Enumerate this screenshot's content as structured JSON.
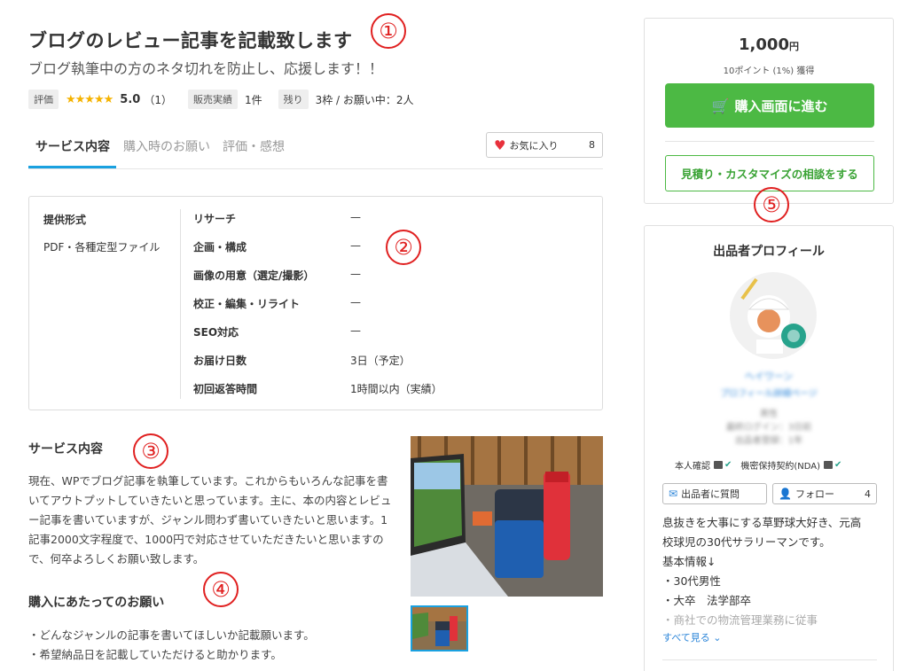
{
  "service": {
    "title": "ブログのレビュー記事を記載致します",
    "subtitle": "ブログ執筆中の方のネタ切れを防止し、応援します！！"
  },
  "meta": {
    "rating_tag": "評価",
    "stars": "★★★★★",
    "rating_value": "5.0",
    "rating_count": "（1）",
    "sales_tag": "販売実績",
    "sales_value": "1件",
    "remaining_tag": "残り",
    "remaining_value": "3枠 / お願い中：2人"
  },
  "tabs": [
    {
      "label": "サービス内容"
    },
    {
      "label": "購入時のお願い"
    },
    {
      "label": "評価・感想"
    }
  ],
  "favorite": {
    "label": "お気に入り",
    "count": "8"
  },
  "spec": {
    "format_label": "提供形式",
    "format_value": "PDF・各種定型ファイル",
    "rows": [
      {
        "k": "リサーチ",
        "v": "—"
      },
      {
        "k": "企画・構成",
        "v": "—"
      },
      {
        "k": "画像の用意（選定/撮影）",
        "v": "—"
      },
      {
        "k": "校正・編集・リライト",
        "v": "—"
      },
      {
        "k": "SEO対応",
        "v": "—"
      },
      {
        "k": "お届け日数",
        "v": "3日（予定）"
      },
      {
        "k": "初回返答時間",
        "v": "1時間以内（実績）"
      }
    ]
  },
  "content": {
    "heading": "サービス内容",
    "body": "現在、WPでブログ記事を執筆しています。これからもいろんな記事を書いてアウトプットしていきたいと思っています。主に、本の内容とレビュー記事を書いていますが、ジャンル問わず書いていきたいと思います。1記事2000文字程度で、1000円で対応させていただきたいと思いますので、何卒よろしくお願い致します。"
  },
  "request": {
    "heading": "購入にあたってのお願い",
    "items": [
      "・どんなジャンルの記事を書いてほしいか記載願います。",
      "・希望納品日を記載していただけると助かります。"
    ]
  },
  "purchase": {
    "price": "1,000",
    "currency": "円",
    "points": "10ポイント (1%) 獲得",
    "buy_label": "購入画面に進む",
    "consult_label": "見積り・カスタマイズの相談をする"
  },
  "profile": {
    "title": "出品者プロフィール",
    "verify_label": "本人確認",
    "nda_label": "機密保持契約(NDA)",
    "message_label": "出品者に質問",
    "follow_label": "フォロー",
    "follow_count": "4",
    "bio_lines": [
      "息抜きを大事にする草野球大好き、元高",
      "校球児の30代サラリーマンです。",
      "基本情報↓",
      "・30代男性",
      "・大卒　法学部卒"
    ],
    "bio_faded": "・商社での物流管理業務に従事",
    "see_all": "すべて見る"
  },
  "annotations": [
    "①",
    "②",
    "③",
    "④",
    "⑤"
  ],
  "colors": {
    "accent_blue": "#1aa1e0",
    "buy_green": "#4cb944",
    "annotation_red": "#e02020",
    "star": "#f5b301"
  }
}
